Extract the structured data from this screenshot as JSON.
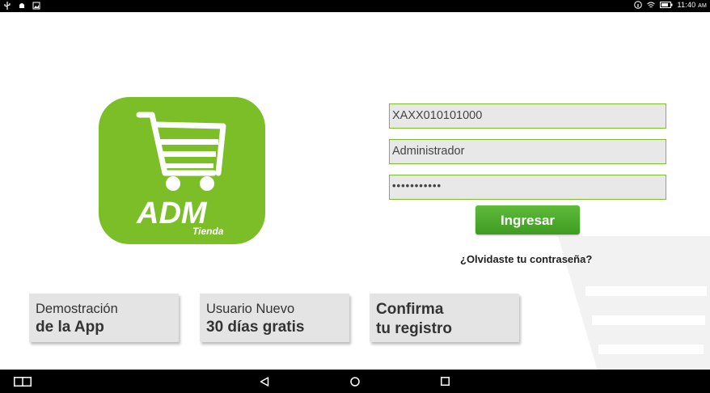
{
  "status_bar": {
    "left_icons": [
      "usb-icon",
      "android-debug-icon",
      "image-icon"
    ],
    "right_icons": [
      "info-icon",
      "wifi-icon",
      "battery-icon"
    ],
    "time": "11:40",
    "ampm": "AM"
  },
  "logo": {
    "brand": "ADM",
    "subtitle": "Tienda",
    "icon": "shopping-cart-icon",
    "color": "#7cbe27"
  },
  "login": {
    "rfc_value": "XAXX010101000",
    "user_value": "Administrador",
    "password_value": "•••••••••••",
    "submit_label": "Ingresar",
    "forgot_label": "¿Olvidaste tu contraseña?"
  },
  "cards": [
    {
      "line1": "Demostración",
      "line2": "de la App"
    },
    {
      "line1": "Usuario Nuevo",
      "line2": "30 días gratis"
    },
    {
      "line1": "Confirma",
      "line2": "tu registro"
    }
  ],
  "nav": [
    "multi-window-icon",
    "back-icon",
    "home-icon",
    "recents-icon"
  ]
}
